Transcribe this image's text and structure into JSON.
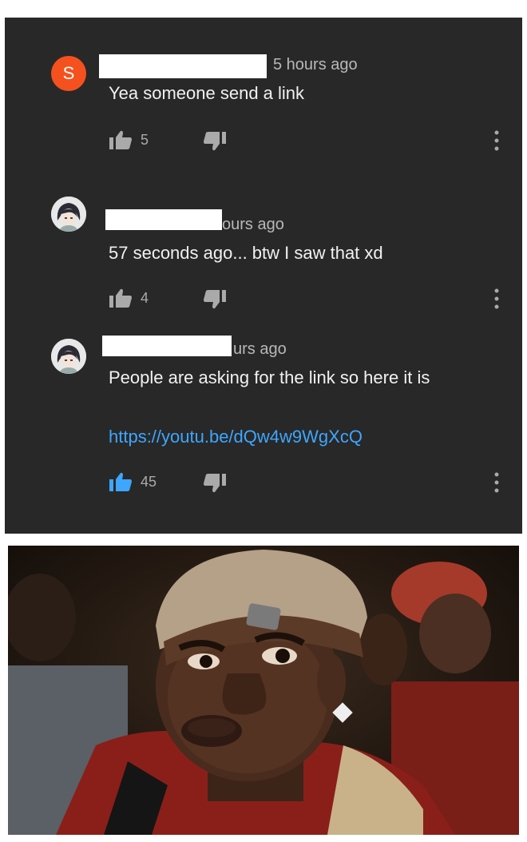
{
  "comments": [
    {
      "avatar_letter": "S",
      "time": "5 hours ago",
      "text": "Yea someone send a link",
      "likes": "5"
    },
    {
      "time": "ours ago",
      "text": "57 seconds ago... btw I saw that xd",
      "likes": "4"
    },
    {
      "time": "urs ago",
      "text": "People are asking for the link so here it is",
      "link": "https://youtu.be/dQw4w9WgXcQ",
      "likes": "45"
    }
  ],
  "colors": {
    "panel_bg": "#282828",
    "link": "#3ea6ff",
    "avatar_orange": "#f4511e",
    "liked_thumb": "#3ea6ff",
    "icon_grey": "#aaaaaa"
  },
  "icons": {
    "like": "thumbs-up-icon",
    "dislike": "thumbs-down-icon",
    "more": "more-vertical-icon"
  },
  "image": {
    "subject": "reaction-photo"
  }
}
